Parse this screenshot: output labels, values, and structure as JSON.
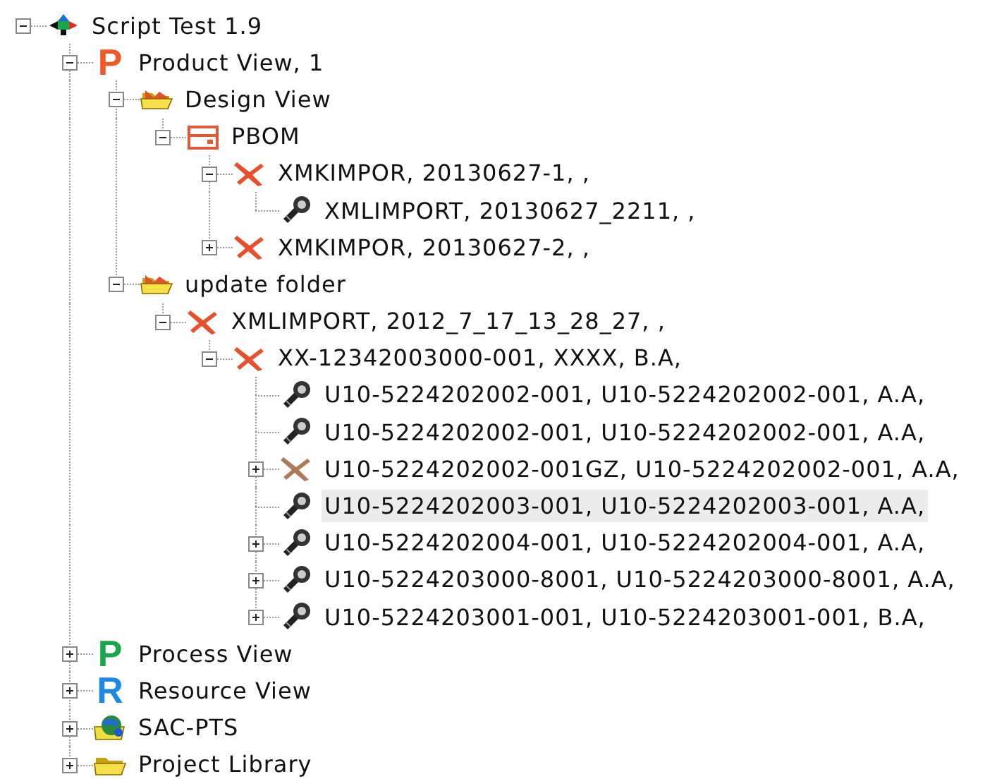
{
  "tree": [
    {
      "label": "Script Test 1.9",
      "kind": "assembly",
      "expanded": true,
      "selected": false,
      "children": [
        {
          "label": "Product View, 1",
          "kind": "letter",
          "glyph": "P",
          "color": "#f05a28",
          "expanded": true,
          "selected": false,
          "children": [
            {
              "label": "Design View",
              "kind": "folder-open",
              "expanded": true,
              "selected": false,
              "children": [
                {
                  "label": "PBOM",
                  "kind": "bom",
                  "expanded": true,
                  "selected": false,
                  "children": [
                    {
                      "label": "XMKIMPOR, 20130627-1, ,",
                      "kind": "plane",
                      "expanded": true,
                      "selected": false,
                      "children": [
                        {
                          "label": "XMLIMPORT, 20130627_2211, ,",
                          "kind": "bolt",
                          "selected": false
                        }
                      ]
                    },
                    {
                      "label": "XMKIMPOR, 20130627-2, ,",
                      "kind": "plane",
                      "expanded": false,
                      "selected": false
                    }
                  ]
                }
              ]
            },
            {
              "label": "update folder",
              "kind": "folder-open",
              "expanded": true,
              "selected": false,
              "children": [
                {
                  "label": "XMLIMPORT, 2012_7_17_13_28_27, ,",
                  "kind": "plane",
                  "expanded": true,
                  "selected": false,
                  "children": [
                    {
                      "label": "XX-12342003000-001, XXXX, B.A,",
                      "kind": "plane",
                      "expanded": true,
                      "selected": false,
                      "children": [
                        {
                          "label": "U10-5224202002-001, U10-5224202002-001, A.A,",
                          "kind": "bolt",
                          "selected": false
                        },
                        {
                          "label": "U10-5224202002-001, U10-5224202002-001, A.A,",
                          "kind": "bolt",
                          "selected": false
                        },
                        {
                          "label": "U10-5224202002-001GZ, U10-5224202002-001, A.A,",
                          "kind": "muted",
                          "expanded": false,
                          "selected": false
                        },
                        {
                          "label": "U10-5224202003-001, U10-5224202003-001, A.A,",
                          "kind": "bolt",
                          "selected": true
                        },
                        {
                          "label": "U10-5224202004-001, U10-5224202004-001, A.A,",
                          "kind": "bolt",
                          "expanded": false,
                          "selected": false
                        },
                        {
                          "label": "U10-5224203000-8001, U10-5224203000-8001, A.A,",
                          "kind": "bolt",
                          "expanded": false,
                          "selected": false
                        },
                        {
                          "label": "U10-5224203001-001, U10-5224203001-001, B.A,",
                          "kind": "bolt",
                          "expanded": false,
                          "selected": false
                        }
                      ]
                    }
                  ]
                }
              ]
            }
          ]
        },
        {
          "label": "Process View",
          "kind": "letter",
          "glyph": "P",
          "color": "#1aa64a",
          "expanded": false,
          "selected": false
        },
        {
          "label": "Resource View",
          "kind": "letter",
          "glyph": "R",
          "color": "#1e88e5",
          "expanded": false,
          "selected": false
        },
        {
          "label": "SAC-PTS",
          "kind": "globe",
          "expanded": false,
          "selected": false
        },
        {
          "label": "Project Library",
          "kind": "folder",
          "expanded": false,
          "selected": false
        }
      ]
    }
  ]
}
